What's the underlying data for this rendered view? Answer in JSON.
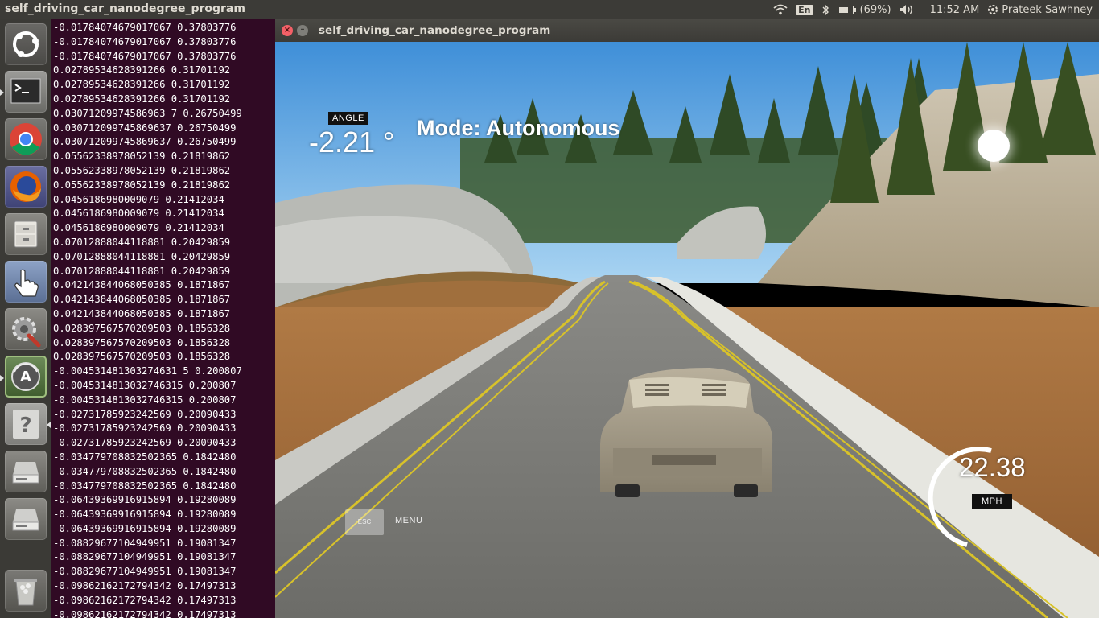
{
  "top_panel": {
    "app_title": "self_driving_car_nanodegree_program",
    "keyboard_layout": "En",
    "battery_text": "(69%)",
    "battery_level": 0.69,
    "time": "11:52 AM",
    "user": "Prateek Sawhney"
  },
  "launcher": {
    "items": [
      {
        "name": "ubuntu-dash",
        "icon": "ubuntu-logo-icon"
      },
      {
        "name": "terminal",
        "icon": "terminal-icon",
        "active": true
      },
      {
        "name": "chrome",
        "icon": "chrome-icon"
      },
      {
        "name": "firefox",
        "icon": "firefox-icon"
      },
      {
        "name": "files",
        "icon": "file-cabinet-icon"
      },
      {
        "name": "touch-settings",
        "icon": "hand-pointer-icon"
      },
      {
        "name": "system-settings",
        "icon": "settings-wrench-icon"
      },
      {
        "name": "software-updater",
        "icon": "software-updater-icon",
        "active": true
      },
      {
        "name": "help",
        "icon": "help-question-icon",
        "active": true
      },
      {
        "name": "drive-1",
        "icon": "hard-drive-icon"
      },
      {
        "name": "drive-2",
        "icon": "hard-drive-icon"
      },
      {
        "name": "trash",
        "icon": "trash-icon"
      }
    ]
  },
  "terminal": {
    "lines": [
      "-0.01784074679017067 0.37803776",
      "-0.01784074679017067 0.37803776",
      "-0.01784074679017067 0.37803776",
      "0.02789534628391266 0.31701192",
      "0.02789534628391266 0.31701192",
      "0.02789534628391266 0.31701192",
      "0.03071209974586963 7 0.26750499",
      "0.030712099745869637 0.26750499",
      "0.030712099745869637 0.26750499",
      "0.05562338978052139 0.21819862",
      "0.05562338978052139 0.21819862",
      "0.05562338978052139 0.21819862",
      "0.0456186980009079 0.21412034",
      "0.0456186980009079 0.21412034",
      "0.0456186980009079 0.21412034",
      "0.07012888044118881 0.20429859",
      "0.07012888044118881 0.20429859",
      "0.07012888044118881 0.20429859",
      "0.042143844068050385 0.1871867",
      "0.042143844068050385 0.1871867",
      "0.042143844068050385 0.1871867",
      "0.028397567570209503 0.1856328",
      "0.028397567570209503 0.1856328",
      "0.028397567570209503 0.1856328",
      "-0.004531481303274631 5 0.200807",
      "-0.0045314813032746315 0.200807",
      "-0.0045314813032746315 0.200807",
      "-0.02731785923242569 0.20090433",
      "-0.02731785923242569 0.20090433",
      "-0.02731785923242569 0.20090433",
      "-0.034779708832502365 0.1842480",
      "-0.034779708832502365 0.1842480",
      "-0.034779708832502365 0.1842480",
      "-0.06439369916915894 0.19280089",
      "-0.06439369916915894 0.19280089",
      "-0.06439369916915894 0.19280089",
      "-0.08829677104949951 0.19081347",
      "-0.08829677104949951 0.19081347",
      "-0.08829677104949951 0.19081347",
      "-0.09862162172794342 0.17497313",
      "-0.09862162172794342 0.17497313",
      "-0.09862162172794342 0.17497313"
    ]
  },
  "simulator": {
    "window_title": "self_driving_car_nanodegree_program",
    "angle_label": "ANGLE",
    "angle_value": "-2.21 °",
    "mode_text": "Mode: Autonomous",
    "speed_value": "22.38",
    "speed_unit": "MPH",
    "esc_key": "ESC",
    "menu_label": "MENU"
  }
}
